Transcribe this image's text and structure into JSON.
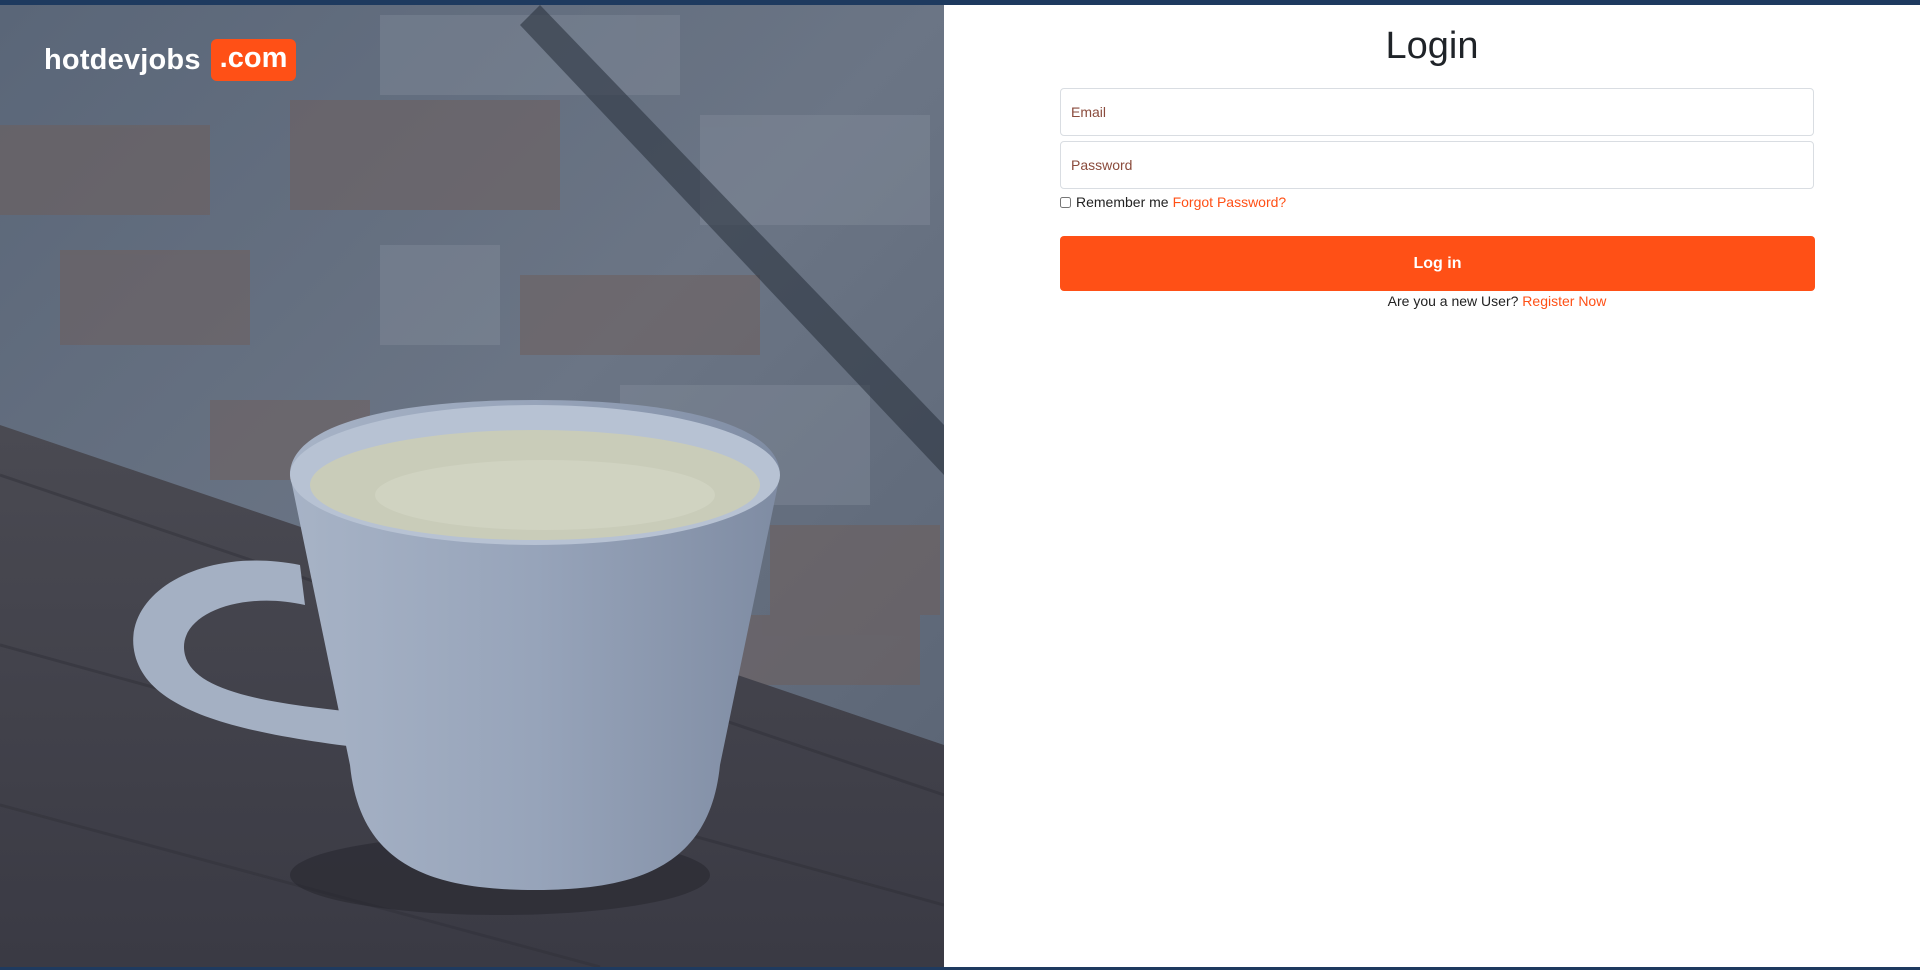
{
  "brand": {
    "name": "hotdevjobs",
    "tld": ".com",
    "accent_color": "#ff5016"
  },
  "hero": {
    "subject": "white coffee cup on wooden table against brick wall"
  },
  "login": {
    "title": "Login",
    "email_placeholder": "Email",
    "password_placeholder": "Password",
    "remember_label": "Remember me",
    "remember_checked": false,
    "forgot_label": "Forgot Password?",
    "submit_label": "Log in",
    "new_user_text": "Are you a new User?",
    "register_label": "Register Now"
  },
  "colors": {
    "top_strip": "#1e3a5f",
    "hero_overlay": "#3a4a5e",
    "title": "#1f2328"
  }
}
